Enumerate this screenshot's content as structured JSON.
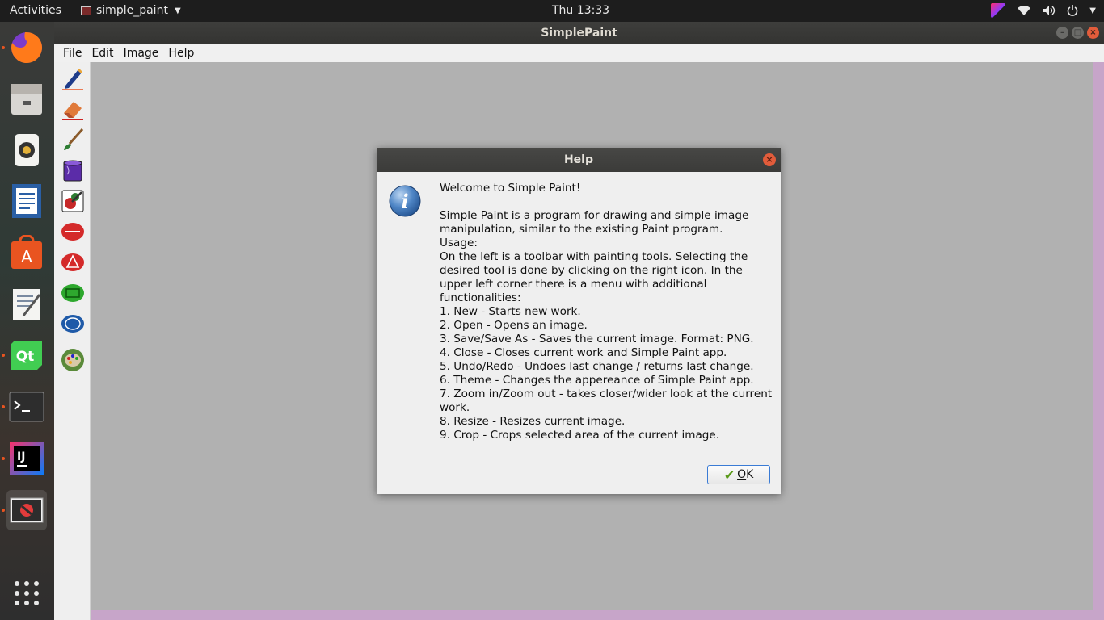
{
  "topbar": {
    "activities": "Activities",
    "app_name": "simple_paint",
    "clock": "Thu 13:33"
  },
  "window": {
    "title": "SimplePaint",
    "menu": [
      "File",
      "Edit",
      "Image",
      "Help"
    ]
  },
  "toolbar": {
    "tools": [
      "pencil-tool",
      "eraser-tool",
      "brush-tool",
      "fill-bucket-tool",
      "color-picker-tool",
      "line-shape-tool",
      "triangle-shape-tool",
      "rectangle-shape-tool",
      "ellipse-shape-tool",
      "palette-tool"
    ]
  },
  "dialog": {
    "title": "Help",
    "welcome": "Welcome to Simple Paint!",
    "intro": "Simple Paint is a program for drawing and simple image manipulation, similar to the existing Paint program.",
    "usage_label": "Usage:",
    "usage_text": "On the left is a toolbar with painting tools. Selecting the desired tool is done by clicking on the right icon. In the upper left corner there is a menu with additional functionalities:",
    "items": [
      "1. New - Starts new work.",
      "2. Open - Opens an image.",
      "3. Save/Save As - Saves the current image. Format: PNG.",
      "4. Close - Closes current work and Simple Paint app.",
      "5. Undo/Redo - Undoes last change / returns last change.",
      "6. Theme - Changes the appereance of Simple Paint app.",
      "7. Zoom in/Zoom out - takes closer/wider look at the current work.",
      "8. Resize - Resizes current image.",
      "9. Crop - Crops selected area of the current image."
    ],
    "ok_mnemonic": "O",
    "ok_rest": "K"
  },
  "colors": {
    "accent_orange": "#e95420",
    "canvas_gray": "#b1b1b1",
    "canvas_border_purple": "#c7a5c9"
  }
}
